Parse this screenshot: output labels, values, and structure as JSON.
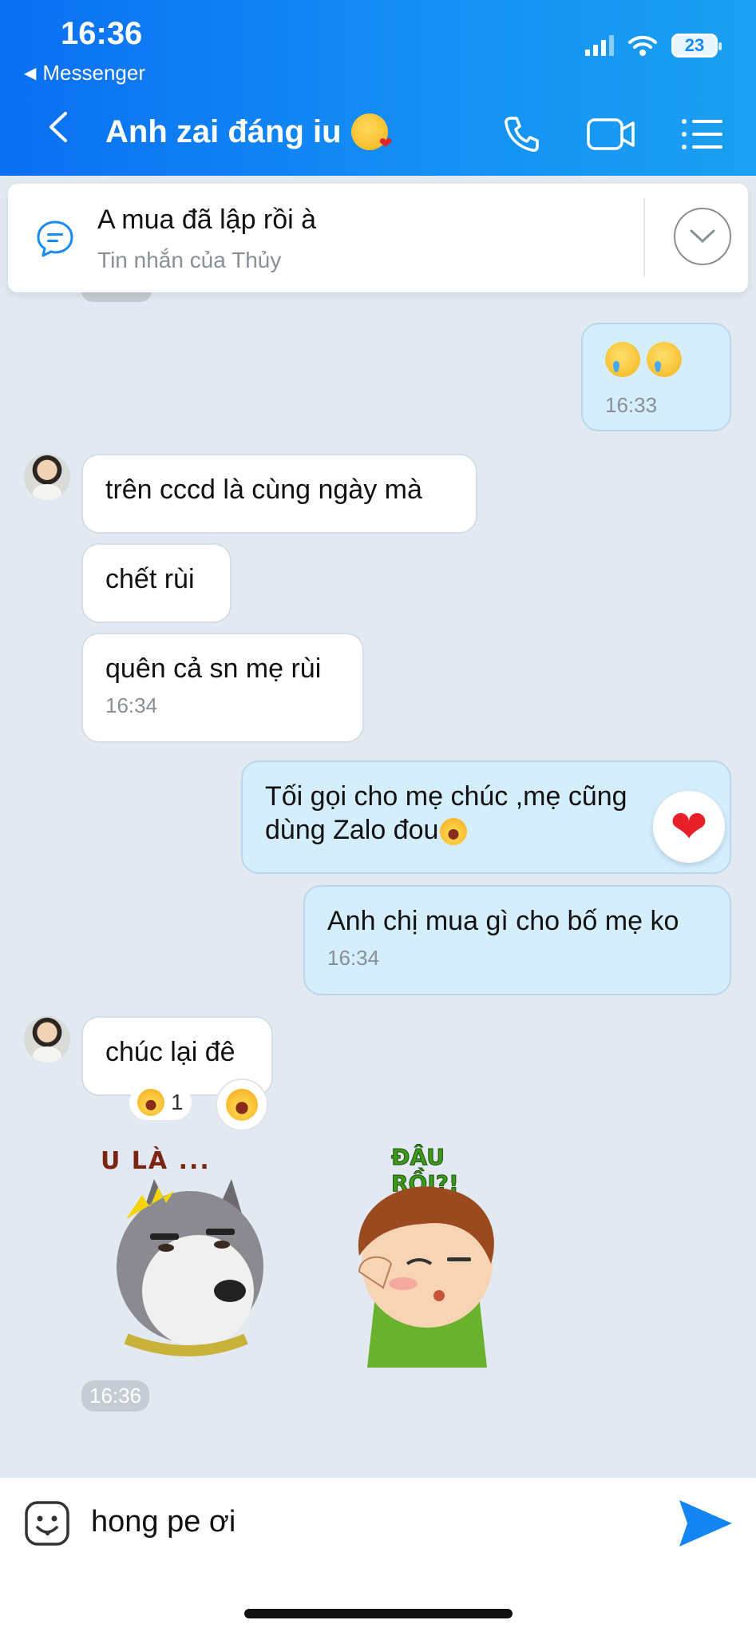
{
  "status_bar": {
    "time": "16:36",
    "back_app": "Messenger",
    "battery": "23"
  },
  "nav": {
    "title": "Anh zai đáng iu"
  },
  "pinned": {
    "text": "A mua đã lập rồi à",
    "sub": "Tin nhắn của Thủy",
    "peek_time": "16:33"
  },
  "messages": [
    {
      "side": "out",
      "time": "16:33"
    },
    {
      "side": "in",
      "text": "trên cccd là cùng ngày mà"
    },
    {
      "side": "in",
      "text": "chết rùi"
    },
    {
      "side": "in",
      "text": "quên cả sn mẹ rùi",
      "time": "16:34"
    },
    {
      "side": "out",
      "text_line1": "Tối gọi cho mẹ chúc ,mẹ cũng",
      "text_line2": "dùng Zalo đou"
    },
    {
      "side": "out",
      "text": "Anh chị mua gì cho bố mẹ ko",
      "time": "16:34"
    },
    {
      "side": "in",
      "text": "chúc lại đê",
      "reaction_count": "1"
    }
  ],
  "stickers": [
    {
      "label": "U LÀ ...",
      "icon": "husky-sticker"
    },
    {
      "label": "ĐÂU RỒI?!",
      "icon": "boy-sticker"
    }
  ],
  "sticker_time": "16:36",
  "composer": {
    "value": "hong pe ơi"
  }
}
